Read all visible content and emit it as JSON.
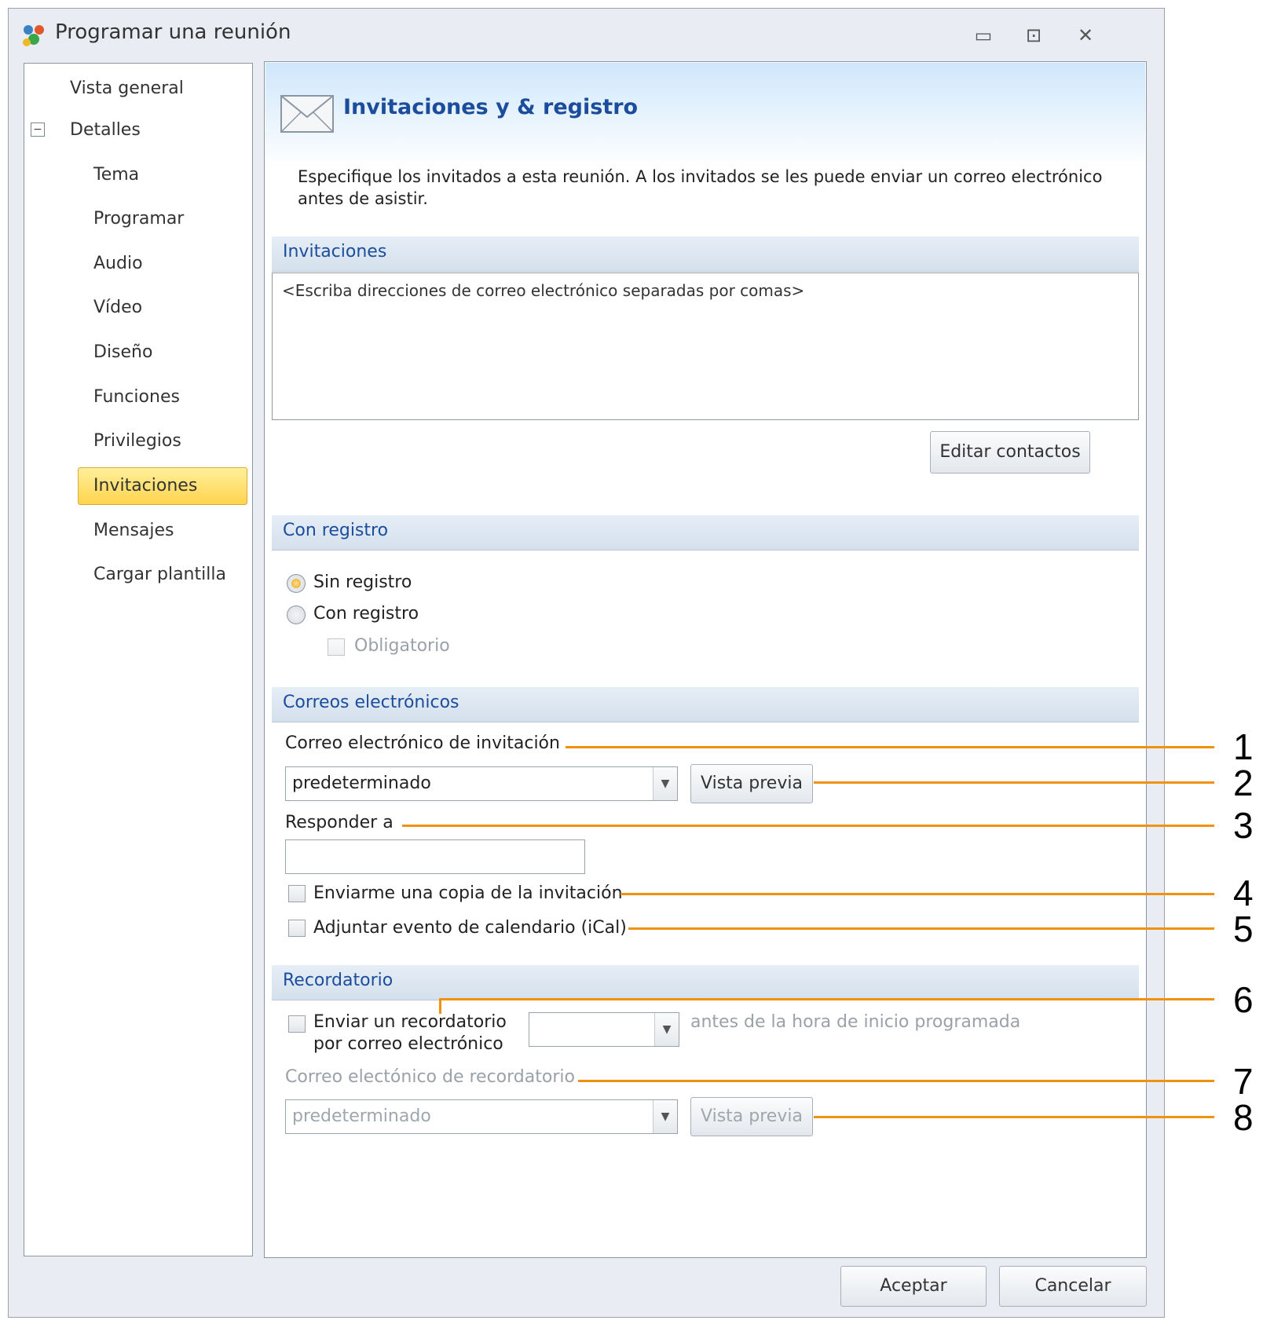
{
  "window": {
    "title": "Programar una reunión",
    "icon": "people-icon",
    "controls": [
      "minimize-icon",
      "restore-icon",
      "close-icon"
    ]
  },
  "sidebar": {
    "items": [
      {
        "label": "Vista general",
        "level": 0
      },
      {
        "label": "Detalles",
        "level": 0,
        "expanded": true
      },
      {
        "label": "Tema",
        "level": 1
      },
      {
        "label": "Programar",
        "level": 1
      },
      {
        "label": "Audio",
        "level": 1
      },
      {
        "label": "Vídeo",
        "level": 1
      },
      {
        "label": "Diseño",
        "level": 1
      },
      {
        "label": "Funciones",
        "level": 1
      },
      {
        "label": "Privilegios",
        "level": 1
      },
      {
        "label": "Invitaciones",
        "level": 1,
        "selected": true
      },
      {
        "label": "Mensajes",
        "level": 1
      },
      {
        "label": "Cargar plantilla",
        "level": 1
      }
    ]
  },
  "page": {
    "title": "Invitaciones y & registro",
    "icon": "envelope-icon",
    "intro": "Especifique los invitados a esta reunión. A los invitados se les puede enviar un correo electrónico antes de asistir."
  },
  "invitations": {
    "heading": "Invitaciones",
    "placeholder": "<Escriba direcciones de correo electrónico separadas por comas>",
    "edit_contacts": "Editar contactos"
  },
  "registration": {
    "heading": "Con registro",
    "option_none": "Sin registro",
    "option_with": "Con registro",
    "required": "Obligatorio",
    "selected": "Sin registro"
  },
  "emails": {
    "heading": "Correos electrónicos",
    "invitation_label": "Correo electrónico de invitación",
    "invitation_value": "predeterminado",
    "preview": "Vista previa",
    "reply_to_label": "Responder a",
    "reply_to_value": "",
    "send_copy": "Enviarme una copia de la invitación",
    "attach_ical": "Adjuntar evento de calendario (iCal)"
  },
  "reminder": {
    "heading": "Recordatorio",
    "send_reminder_line1": "Enviar un recordatorio",
    "send_reminder_line2": "por correo electrónico",
    "time_value": "",
    "before_text": "antes de la hora de inicio programada",
    "email_label": "Correo electónico de recordatorio",
    "email_value": "predeterminado",
    "preview": "Vista previa"
  },
  "footer": {
    "ok": "Aceptar",
    "cancel": "Cancelar"
  },
  "callouts": [
    "1",
    "2",
    "3",
    "4",
    "5",
    "6",
    "7",
    "8"
  ],
  "colors": {
    "accent_title": "#1b4d9c",
    "callout_line": "#f0920f",
    "selected_item": "#ffd44e"
  }
}
